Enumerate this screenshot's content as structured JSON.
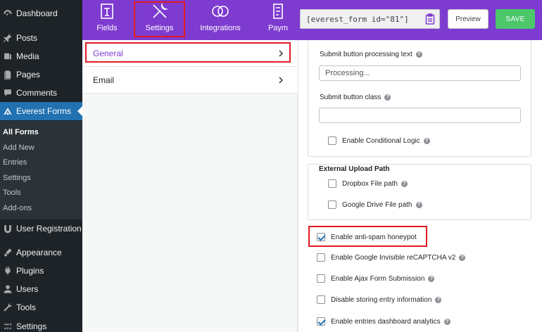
{
  "wp_menu": {
    "items": [
      {
        "label": "Dashboard",
        "icon": "dashboard-icon"
      },
      {
        "label": "Posts",
        "icon": "pin-icon"
      },
      {
        "label": "Media",
        "icon": "media-icon"
      },
      {
        "label": "Pages",
        "icon": "pages-icon"
      },
      {
        "label": "Comments",
        "icon": "comments-icon"
      },
      {
        "label": "Everest Forms",
        "icon": "everest-forms-icon"
      },
      {
        "label": "User Registration",
        "icon": "user-registration-icon"
      },
      {
        "label": "Appearance",
        "icon": "appearance-icon"
      },
      {
        "label": "Plugins",
        "icon": "plugins-icon"
      },
      {
        "label": "Users",
        "icon": "users-icon"
      },
      {
        "label": "Tools",
        "icon": "tools-icon"
      },
      {
        "label": "Settings",
        "icon": "settings-icon"
      }
    ],
    "submenu": [
      "All Forms",
      "Add New",
      "Entries",
      "Settings",
      "Tools",
      "Add-ons"
    ]
  },
  "builder_tabs": [
    {
      "label": "Fields",
      "icon": "fields-icon"
    },
    {
      "label": "Settings",
      "icon": "settings-tools-icon"
    },
    {
      "label": "Integrations",
      "icon": "integrations-icon"
    },
    {
      "label": "Paym",
      "icon": "payments-icon"
    }
  ],
  "toolbar": {
    "shortcode": "[everest_form id=\"81\"]",
    "preview_label": "Preview",
    "save_label": "SAVE"
  },
  "sections": [
    "General",
    "Email"
  ],
  "settings": {
    "submit_processing_label": "Submit button processing text",
    "submit_processing_value": "Processing...",
    "submit_class_label": "Submit button class",
    "submit_class_value": "",
    "conditional_logic_label": "Enable Conditional Logic",
    "upload_path_title": "External Upload Path",
    "dropbox_label": "Dropbox File path",
    "gdrive_label": "Google Drive File path",
    "honeypot_label": "Enable anti-spam honeypot",
    "recaptcha_label": "Enable Google Invisible reCAPTCHA v2",
    "ajax_label": "Enable Ajax Form Submission",
    "disable_entry_label": "Disable storing entry information",
    "analytics_label": "Enable entries dashboard analytics"
  },
  "colors": {
    "brand_purple": "#7e3bd0",
    "save_green": "#4cc76a",
    "wp_active_blue": "#2271b1",
    "highlight_red": "#e01b24"
  }
}
